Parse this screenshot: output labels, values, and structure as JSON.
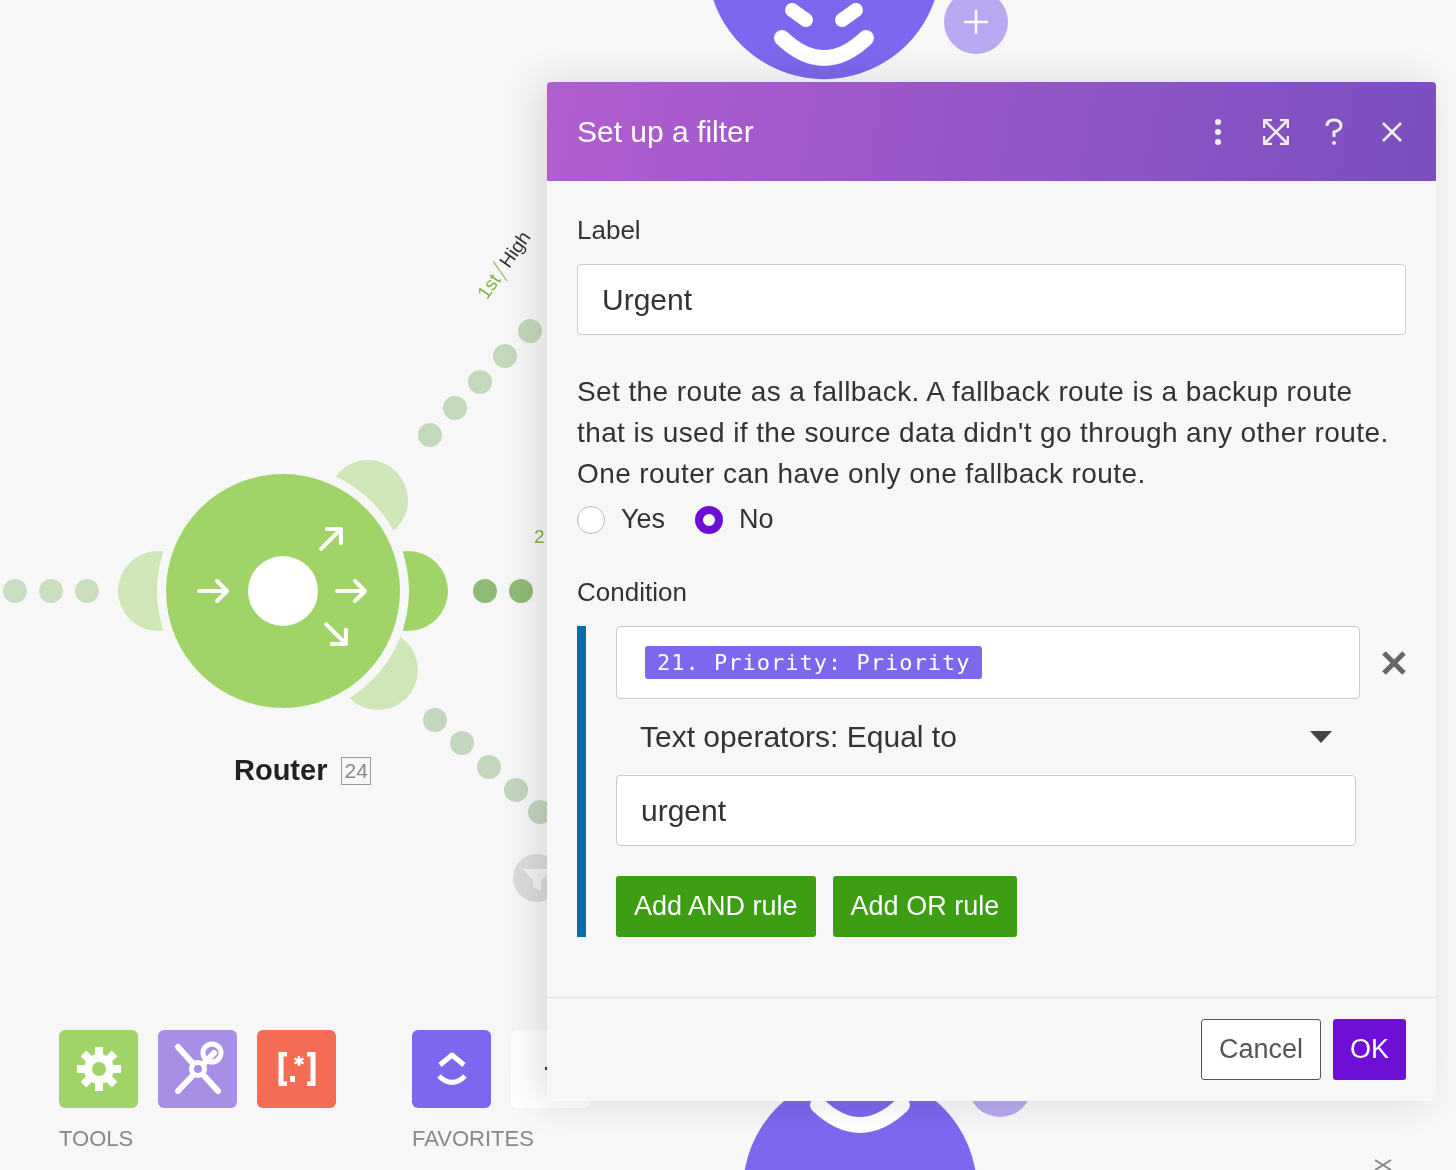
{
  "canvas": {
    "routes": [
      {
        "order": "1st",
        "name": "High"
      },
      {
        "order": "2"
      }
    ],
    "router": {
      "title": "Router",
      "badge": "24"
    },
    "toolbar": {
      "groups": [
        {
          "label": "TOOLS"
        },
        {
          "label": "FAVORITES"
        }
      ]
    }
  },
  "dialog": {
    "title": "Set up a filter",
    "label": {
      "caption": "Label",
      "value": "Urgent"
    },
    "fallback": {
      "text": "Set the route as a fallback. A fallback route is a backup route that is used if the source data didn't go through any other route. One router can have only one fallback route.",
      "options": [
        {
          "label": "Yes",
          "selected": false
        },
        {
          "label": "No",
          "selected": true
        }
      ]
    },
    "condition": {
      "caption": "Condition",
      "token": "21. Priority: Priority",
      "operator": "Text operators: Equal to",
      "value": "urgent",
      "buttons": [
        "Add AND rule",
        "Add OR rule"
      ]
    },
    "footer": {
      "buttons": [
        {
          "label": "Cancel",
          "kind": "secondary"
        },
        {
          "label": "OK",
          "kind": "primary"
        }
      ]
    }
  }
}
